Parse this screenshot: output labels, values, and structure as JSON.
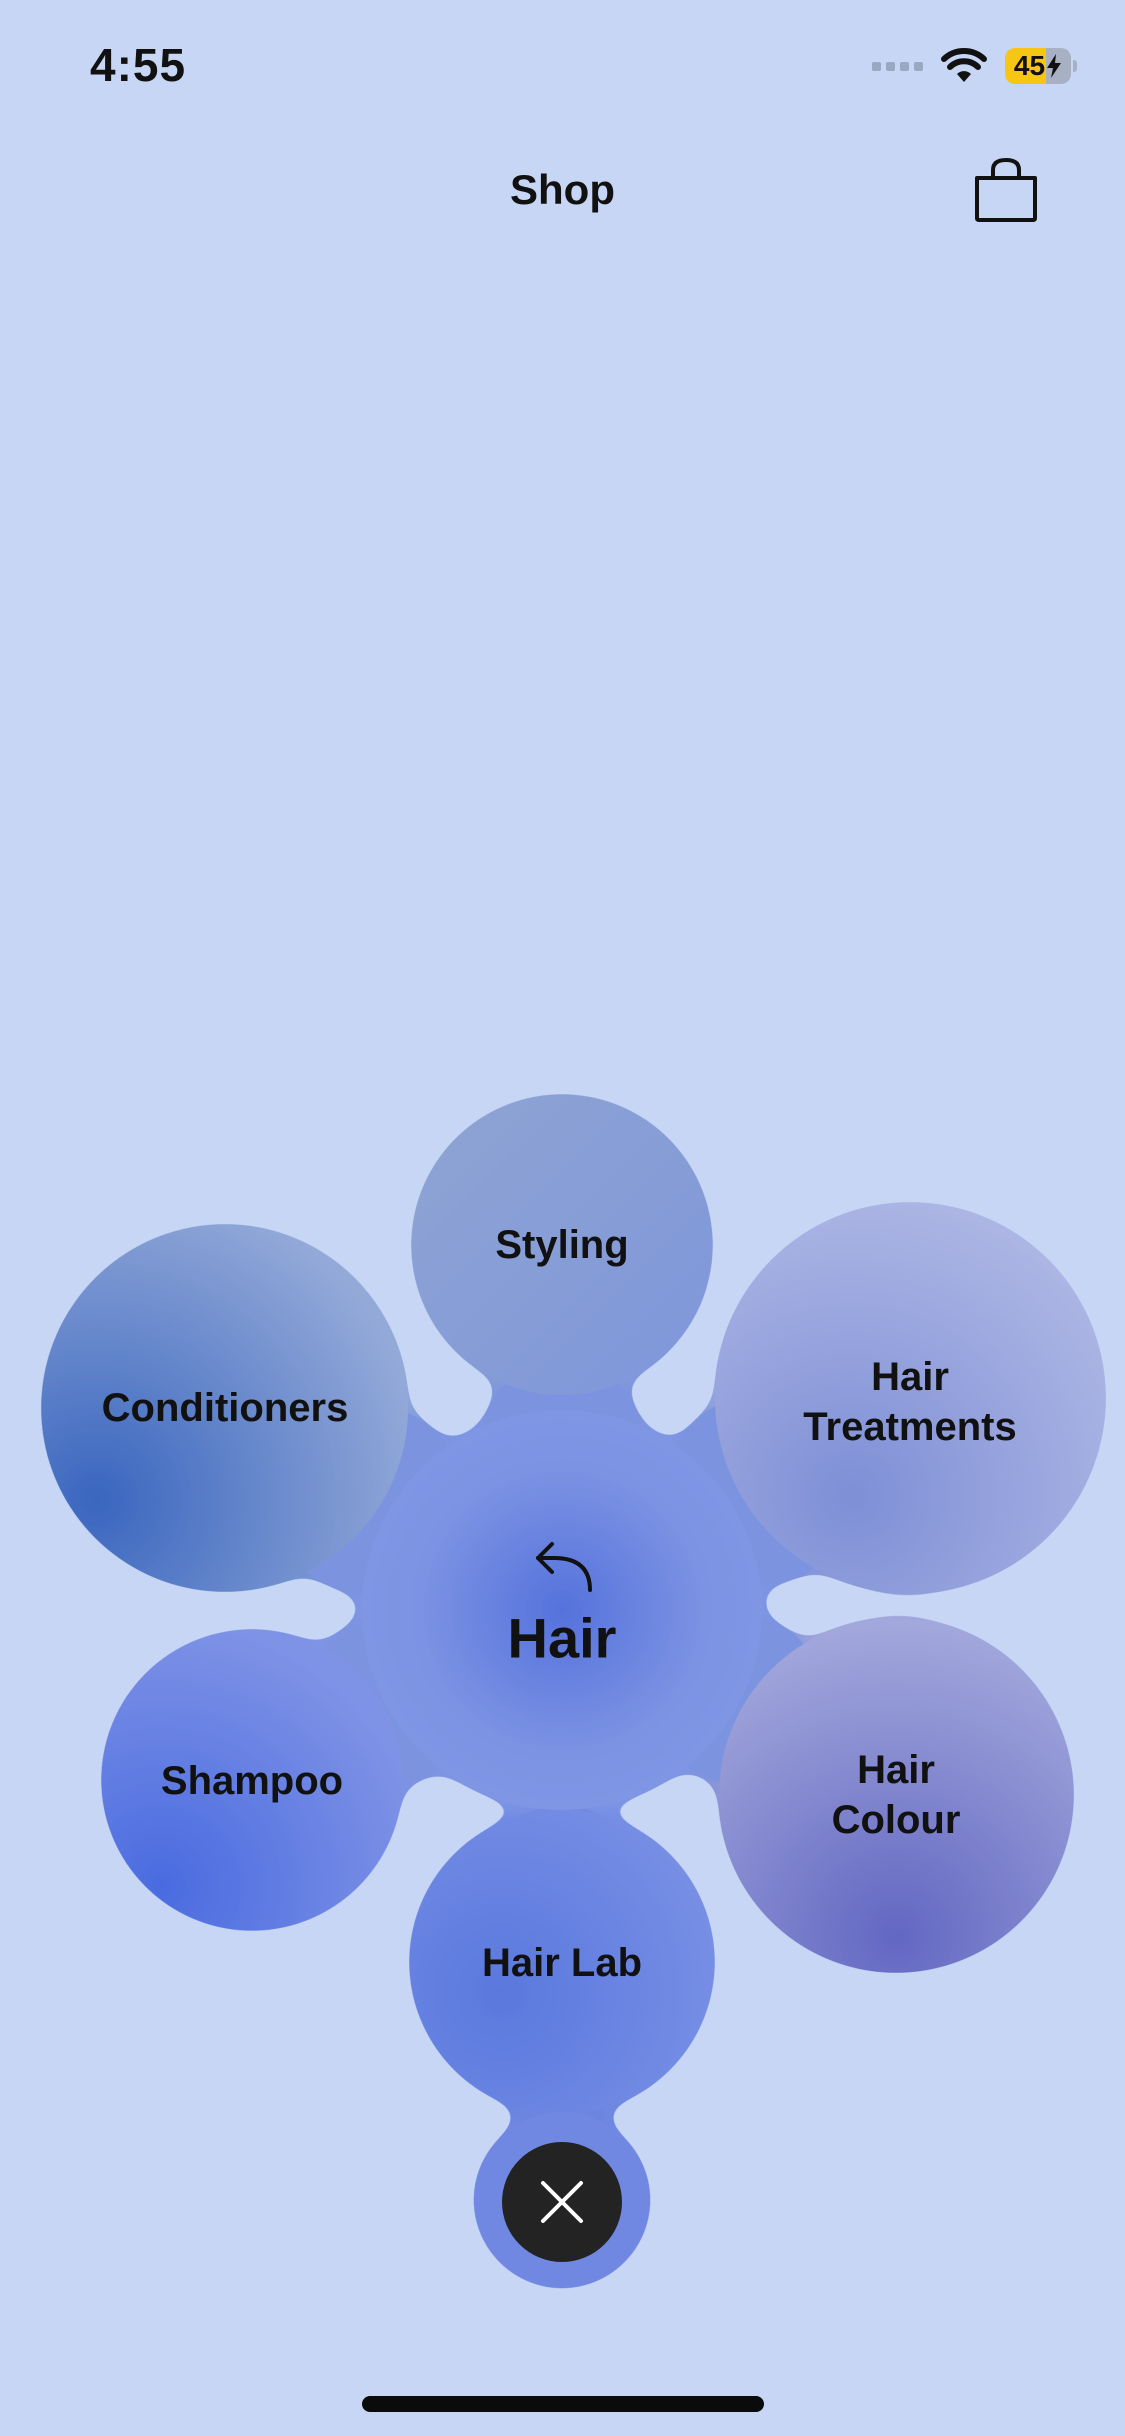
{
  "status_bar": {
    "time": "4:55",
    "battery_level": "45",
    "wifi_icon": "wifi-icon",
    "battery_color": "#f7c514"
  },
  "header": {
    "title": "Shop",
    "bag_icon": "shopping-bag-icon"
  },
  "menu": {
    "center_label": "Hair",
    "back_icon": "back-arrow-icon",
    "petals": [
      {
        "lines": [
          "Styling"
        ]
      },
      {
        "lines": [
          "Conditioners"
        ]
      },
      {
        "lines": [
          "Hair",
          "Treatments"
        ]
      },
      {
        "lines": [
          "Shampoo"
        ]
      },
      {
        "lines": [
          "Hair",
          "Colour"
        ]
      },
      {
        "lines": [
          "Hair Lab"
        ]
      }
    ],
    "close_icon": "close-icon"
  },
  "colors": {
    "background": "#c6d6f4",
    "blob_center": "#5a76de",
    "close_button": "#232323"
  }
}
